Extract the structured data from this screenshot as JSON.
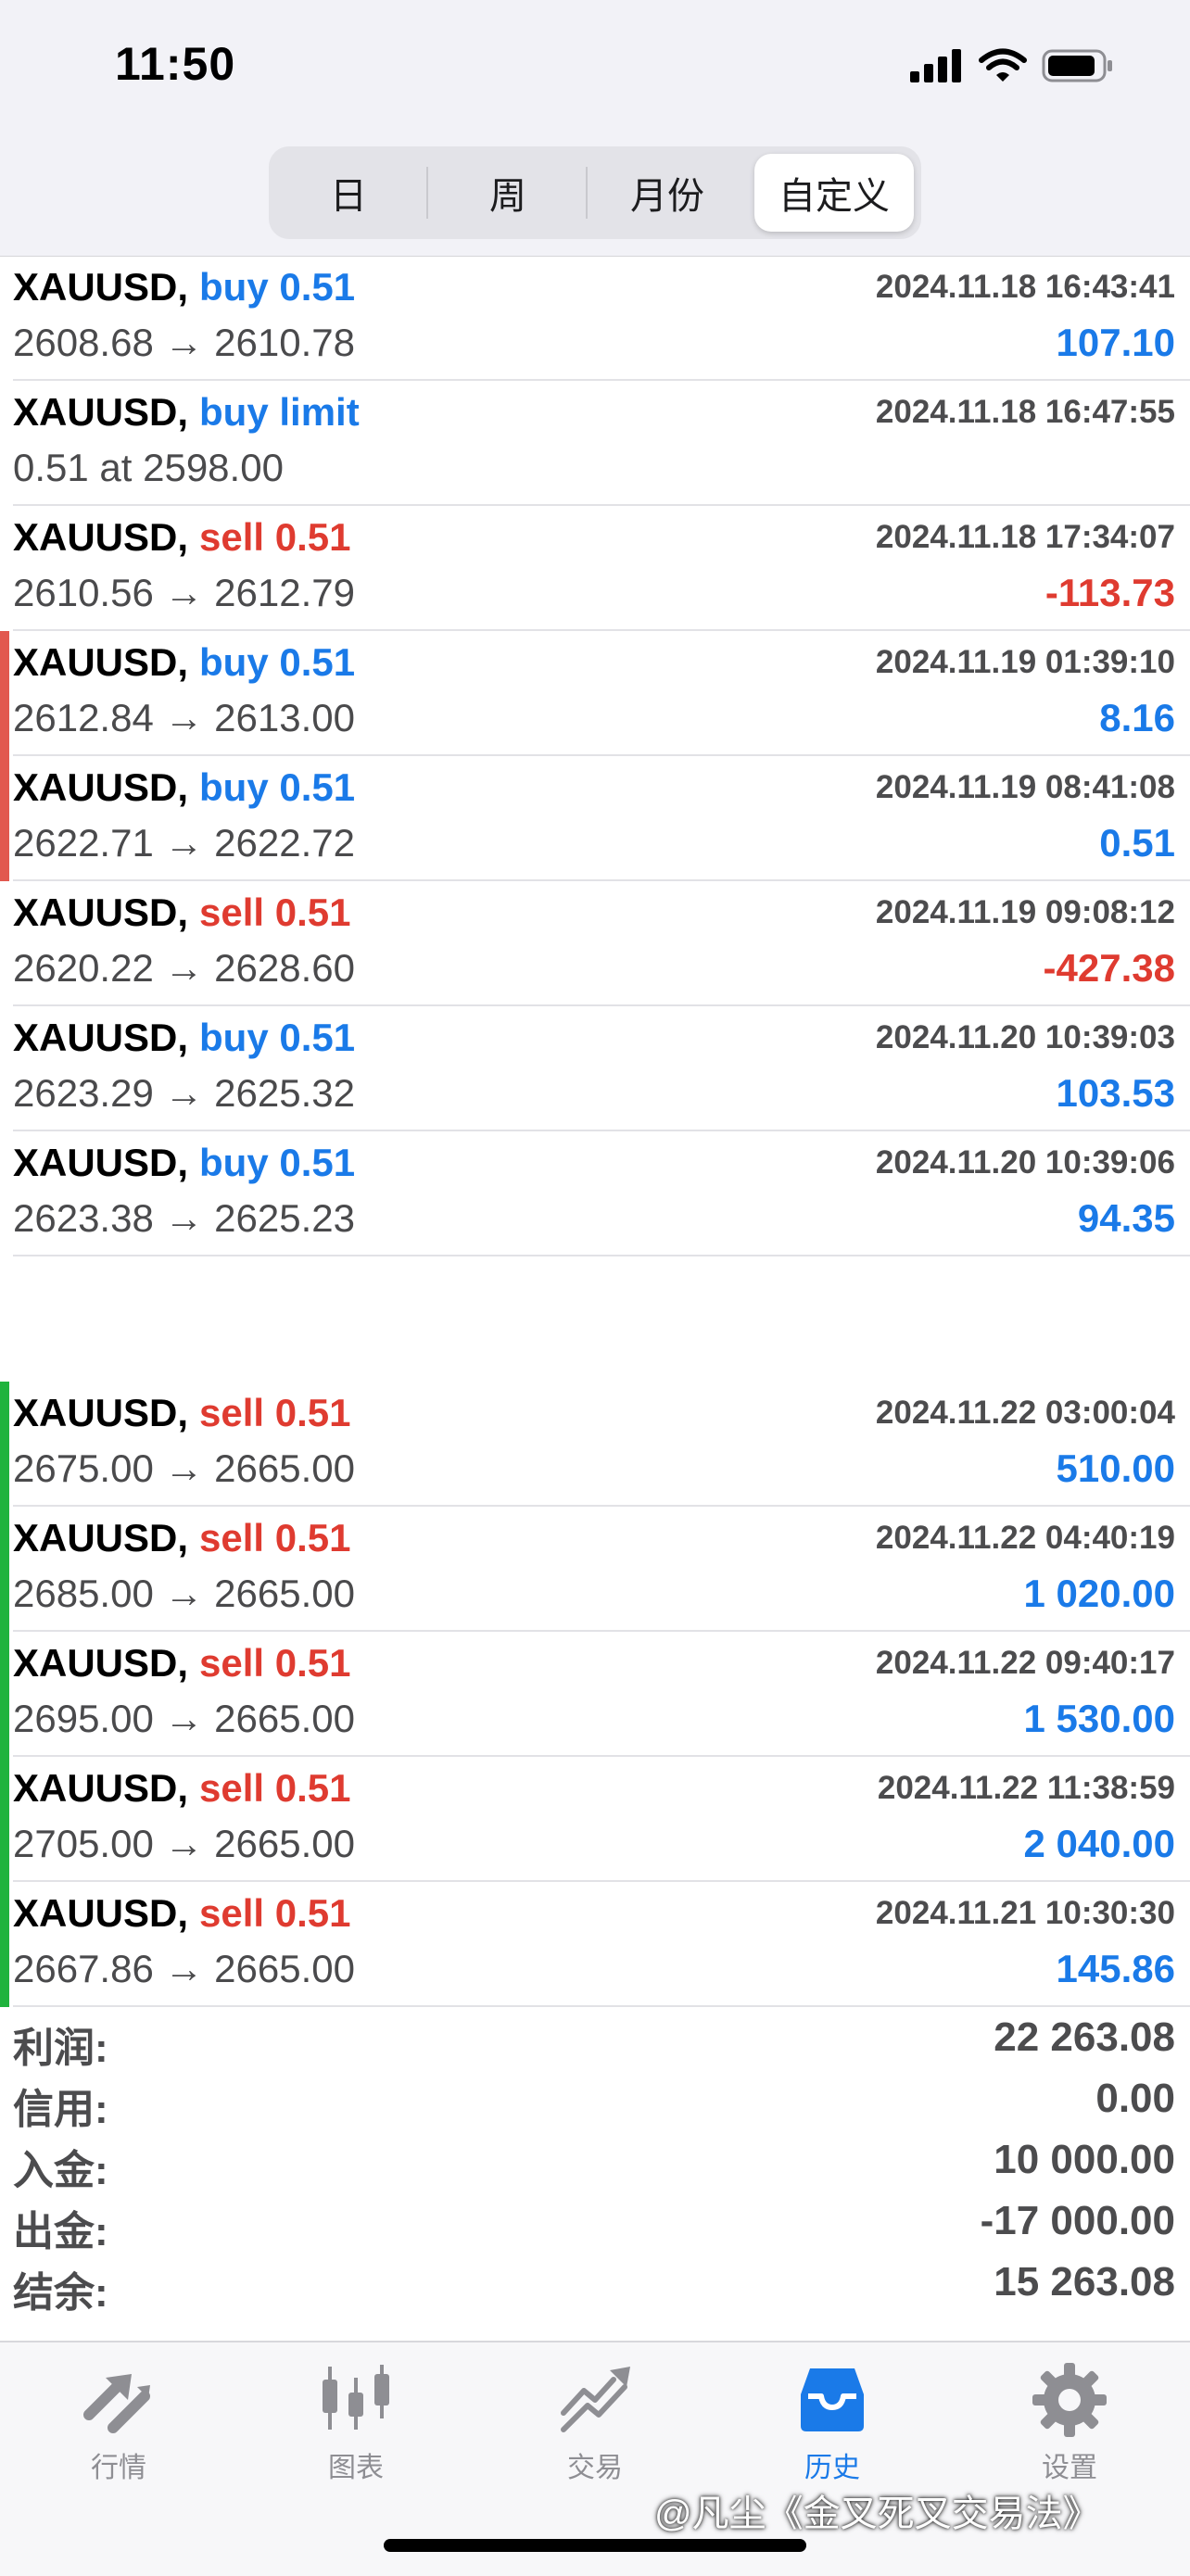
{
  "status_bar": {
    "time": "11:50"
  },
  "period_tabs": [
    {
      "label": "日",
      "active": false
    },
    {
      "label": "周",
      "active": false
    },
    {
      "label": "月份",
      "active": false
    },
    {
      "label": "自定义",
      "active": true
    }
  ],
  "trades": [
    {
      "symbol": "XAUUSD,",
      "action": "buy 0.51",
      "side": "buy",
      "time": "2024.11.18 16:43:41",
      "prices": "2608.68 → 2610.78",
      "profit": "107.10",
      "profit_sign": "pos",
      "marker": "none"
    },
    {
      "symbol": "XAUUSD,",
      "action": "buy limit",
      "side": "buy",
      "time": "2024.11.18 16:47:55",
      "prices": "0.51 at 2598.00",
      "profit": "",
      "profit_sign": "pos",
      "marker": "none"
    },
    {
      "symbol": "XAUUSD,",
      "action": "sell 0.51",
      "side": "sell",
      "time": "2024.11.18 17:34:07",
      "prices": "2610.56 → 2612.79",
      "profit": "-113.73",
      "profit_sign": "neg",
      "marker": "none"
    },
    {
      "symbol": "XAUUSD,",
      "action": "buy 0.51",
      "side": "buy",
      "time": "2024.11.19 01:39:10",
      "prices": "2612.84 → 2613.00",
      "profit": "8.16",
      "profit_sign": "pos",
      "marker": "red"
    },
    {
      "symbol": "XAUUSD,",
      "action": "buy 0.51",
      "side": "buy",
      "time": "2024.11.19 08:41:08",
      "prices": "2622.71 → 2622.72",
      "profit": "0.51",
      "profit_sign": "pos",
      "marker": "red"
    },
    {
      "symbol": "XAUUSD,",
      "action": "sell 0.51",
      "side": "sell",
      "time": "2024.11.19 09:08:12",
      "prices": "2620.22 → 2628.60",
      "profit": "-427.38",
      "profit_sign": "neg",
      "marker": "none"
    },
    {
      "symbol": "XAUUSD,",
      "action": "buy 0.51",
      "side": "buy",
      "time": "2024.11.20 10:39:03",
      "prices": "2623.29 → 2625.32",
      "profit": "103.53",
      "profit_sign": "pos",
      "marker": "none"
    },
    {
      "symbol": "XAUUSD,",
      "action": "buy 0.51",
      "side": "buy",
      "time": "2024.11.20 10:39:06",
      "prices": "2623.38 → 2625.23",
      "profit": "94.35",
      "profit_sign": "pos",
      "marker": "none"
    },
    {
      "symbol": "XAUUSD,",
      "action": "sell 0.51",
      "side": "sell",
      "time": "2024.11.22 03:00:04",
      "prices": "2675.00 → 2665.00",
      "profit": "510.00",
      "profit_sign": "pos",
      "marker": "green"
    },
    {
      "symbol": "XAUUSD,",
      "action": "sell 0.51",
      "side": "sell",
      "time": "2024.11.22 04:40:19",
      "prices": "2685.00 → 2665.00",
      "profit": "1 020.00",
      "profit_sign": "pos",
      "marker": "green"
    },
    {
      "symbol": "XAUUSD,",
      "action": "sell 0.51",
      "side": "sell",
      "time": "2024.11.22 09:40:17",
      "prices": "2695.00 → 2665.00",
      "profit": "1 530.00",
      "profit_sign": "pos",
      "marker": "green"
    },
    {
      "symbol": "XAUUSD,",
      "action": "sell 0.51",
      "side": "sell",
      "time": "2024.11.22 11:38:59",
      "prices": "2705.00 → 2665.00",
      "profit": "2 040.00",
      "profit_sign": "pos",
      "marker": "green"
    },
    {
      "symbol": "XAUUSD,",
      "action": "sell 0.51",
      "side": "sell",
      "time": "2024.11.21 10:30:30",
      "prices": "2667.86 → 2665.00",
      "profit": "145.86",
      "profit_sign": "pos",
      "marker": "green"
    }
  ],
  "summary": [
    {
      "label": "利润:",
      "value": "22 263.08"
    },
    {
      "label": "信用:",
      "value": "0.00"
    },
    {
      "label": "入金:",
      "value": "10 000.00"
    },
    {
      "label": "出金:",
      "value": "-17 000.00"
    },
    {
      "label": "结余:",
      "value": "15 263.08"
    }
  ],
  "tabbar": [
    {
      "label": "行情",
      "icon": "quotes-arrows-icon",
      "active": false
    },
    {
      "label": "图表",
      "icon": "candlestick-chart-icon",
      "active": false
    },
    {
      "label": "交易",
      "icon": "trade-chart-icon",
      "active": false
    },
    {
      "label": "历史",
      "icon": "history-inbox-icon",
      "active": true
    },
    {
      "label": "设置",
      "icon": "gear-icon",
      "active": false
    }
  ],
  "watermark": "@凡尘《金叉死叉交易法》",
  "colors": {
    "buy": "#1a7ae8",
    "sell": "#df3b30",
    "marker_red": "#e2584f",
    "marker_green": "#1fb33d",
    "active_tab": "#1a7ae8"
  }
}
